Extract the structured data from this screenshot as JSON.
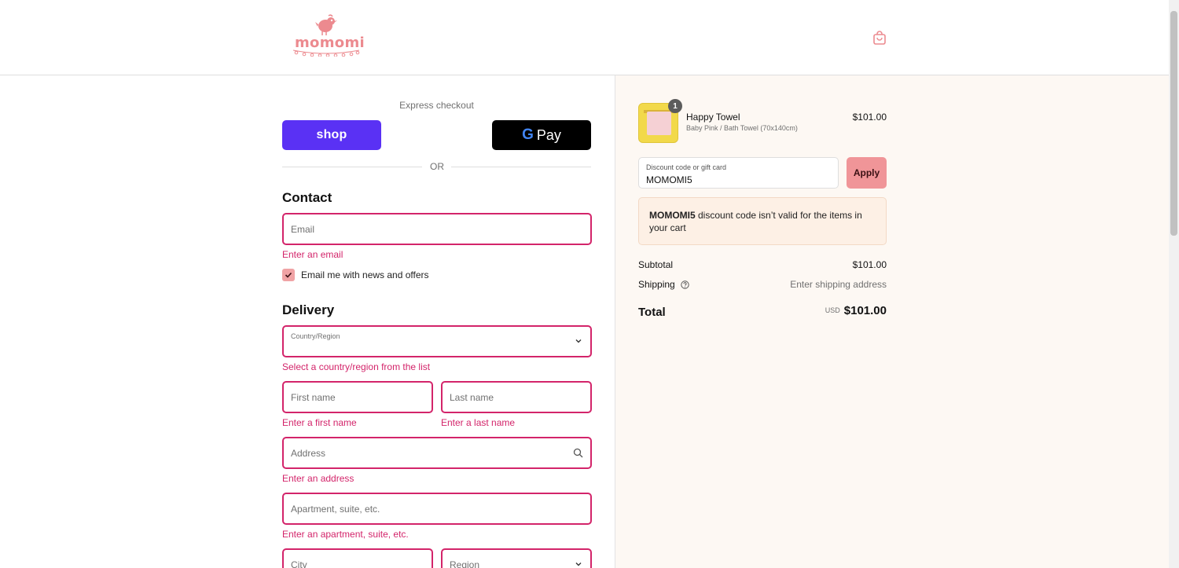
{
  "brand": {
    "logo_text": "momomi",
    "accent_color": "#ec8a8f",
    "error_color": "#d3246a"
  },
  "header": {
    "cart_icon": "shopping-bag-icon"
  },
  "express": {
    "label": "Express checkout",
    "shop_label": "shop",
    "gpay_label": "Pay",
    "gpay_g": "G",
    "or_label": "OR"
  },
  "contact": {
    "title": "Contact",
    "email_placeholder": "Email",
    "email_error": "Enter an email",
    "newsletter_label": "Email me with news and offers",
    "newsletter_checked": true
  },
  "delivery": {
    "title": "Delivery",
    "country_label": "Country/Region",
    "country_error": "Select a country/region from the list",
    "first_name_placeholder": "First name",
    "first_name_error": "Enter a first name",
    "last_name_placeholder": "Last name",
    "last_name_error": "Enter a last name",
    "address_placeholder": "Address",
    "address_error": "Enter an address",
    "apartment_placeholder": "Apartment, suite, etc.",
    "apartment_error": "Enter an apartment, suite, etc.",
    "city_placeholder": "City",
    "region_placeholder": "Region"
  },
  "order": {
    "item": {
      "name": "Happy Towel",
      "variant": "Baby Pink / Bath Towel (70x140cm)",
      "price": "$101.00",
      "quantity": "1"
    },
    "discount": {
      "label": "Discount code or gift card",
      "value": "MOMOMI5",
      "apply_label": "Apply"
    },
    "notice": {
      "code": "MOMOMI5",
      "message": " discount code isn’t valid for the items in your cart"
    },
    "subtotal_label": "Subtotal",
    "subtotal_value": "$101.00",
    "shipping_label": "Shipping",
    "shipping_value": "Enter shipping address",
    "total_label": "Total",
    "currency": "USD",
    "total_value": "$101.00"
  }
}
